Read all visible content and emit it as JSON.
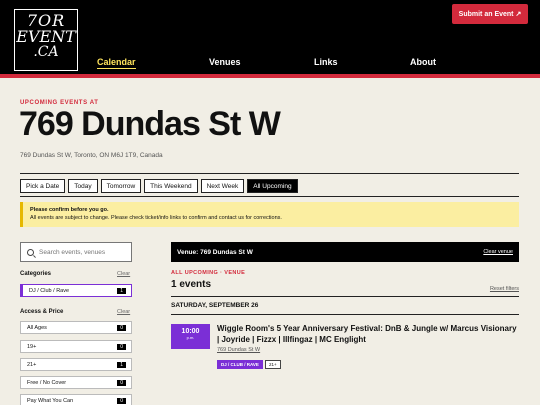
{
  "header": {
    "logo": {
      "line1": "7OR",
      "line2": "EVENT",
      "line3": ".CA"
    },
    "submit_label": "Submit an Event ↗",
    "nav": [
      {
        "label": "Calendar",
        "active": true
      },
      {
        "label": "Venues",
        "active": false
      },
      {
        "label": "Links",
        "active": false
      },
      {
        "label": "About",
        "active": false
      }
    ]
  },
  "page": {
    "eyebrow": "UPCOMING EVENTS AT",
    "title": "769 Dundas St W",
    "address": "769 Dundas St W, Toronto, ON M6J 1T9, Canada"
  },
  "date_filters": [
    "Pick a Date",
    "Today",
    "Tomorrow",
    "This Weekend",
    "Next Week",
    "All Upcoming"
  ],
  "active_filter": "All Upcoming",
  "notice": {
    "title": "Please confirm before you go.",
    "body": "All events are subject to change. Please check ticket/info links to confirm and contact us for corrections."
  },
  "sidebar": {
    "search_placeholder": "Search events, venues",
    "categories": {
      "heading": "Categories",
      "clear": "Clear",
      "items": [
        {
          "label": "DJ / Club / Rave",
          "count": "1",
          "selected": true
        }
      ]
    },
    "access": {
      "heading": "Access & Price",
      "clear": "Clear",
      "items": [
        {
          "label": "All Ages",
          "count": "0"
        },
        {
          "label": "19+",
          "count": "0"
        },
        {
          "label": "21+",
          "count": "1"
        },
        {
          "label": "Free / No Cover",
          "count": "0"
        },
        {
          "label": "Pay What You Can",
          "count": "0"
        }
      ]
    }
  },
  "results": {
    "venue_bar": "Venue: 769 Dundas St W",
    "clear_venue": "Clear venue",
    "meta": "ALL UPCOMING · VENUE",
    "count": "1 events",
    "reset": "Reset filters",
    "date_heading": "SATURDAY, SEPTEMBER 26",
    "event": {
      "time": "10:00",
      "ampm": "p.m.",
      "title": "Wiggle Room's 5 Year Anniversary Festival: DnB & Jungle w/ Marcus Visionary | Joyride | Fizzx | Illfingaz | MC Englight",
      "venue": "769 Dundas St W",
      "genre_tag": "DJ / CLUB / RAVE",
      "age_tag": "21+"
    }
  },
  "colors": {
    "accent": "#d32a3c",
    "highlight": "#ffe45c",
    "purple": "#7b2fd6",
    "bg": "#f1eee5"
  }
}
